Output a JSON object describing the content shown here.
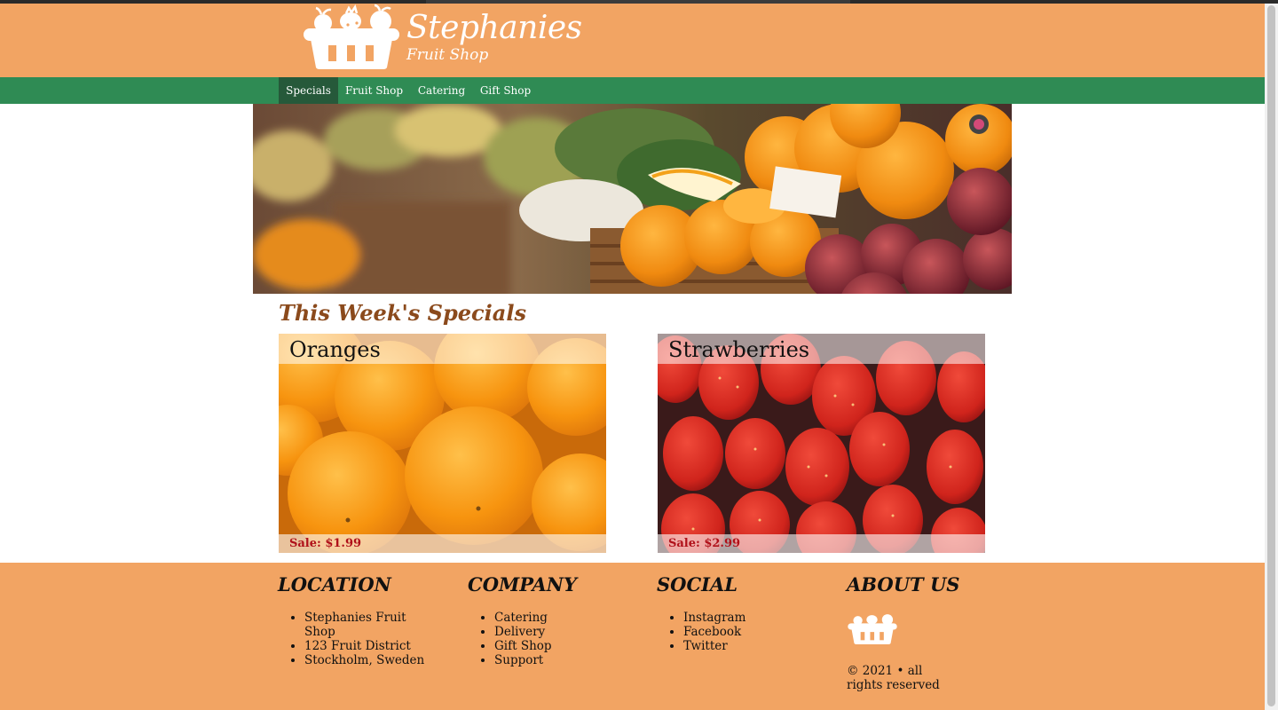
{
  "brand": {
    "title": "Stephanies",
    "subtitle": "Fruit Shop",
    "logo_icon": "fruit-basket-icon"
  },
  "nav": {
    "items": [
      {
        "label": "Specials",
        "active": true
      },
      {
        "label": "Fruit Shop",
        "active": false
      },
      {
        "label": "Catering",
        "active": false
      },
      {
        "label": "Gift Shop",
        "active": false
      }
    ]
  },
  "specials": {
    "title": "This Week's Specials",
    "items": [
      {
        "name": "Oranges",
        "price": "Sale: $1.99"
      },
      {
        "name": "Strawberries",
        "price": "Sale: $2.99"
      }
    ]
  },
  "footer": {
    "location": {
      "heading": "LOCATION",
      "items": [
        "Stephanies Fruit Shop",
        "123 Fruit District",
        "Stockholm, Sweden"
      ]
    },
    "company": {
      "heading": "COMPANY",
      "items": [
        "Catering",
        "Delivery",
        "Gift Shop",
        "Support"
      ]
    },
    "social": {
      "heading": "SOCIAL",
      "items": [
        "Instagram",
        "Facebook",
        "Twitter"
      ]
    },
    "about": {
      "heading": "ABOUT US",
      "copyright": "© 2021 • all rights reserved"
    }
  },
  "colors": {
    "header_bg": "#f2a463",
    "nav_bg": "#2f8b54",
    "nav_active_bg": "#26593a",
    "specials_title": "#8b4a1c",
    "price_red": "#b0111a"
  }
}
